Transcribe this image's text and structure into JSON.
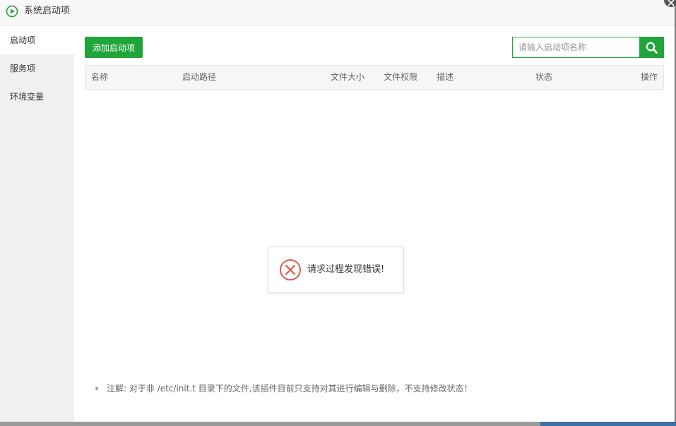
{
  "window": {
    "title": "系统启动项",
    "icon": "play-circle-icon"
  },
  "sidebar": {
    "items": [
      {
        "label": "启动项",
        "active": true
      },
      {
        "label": "服务项",
        "active": false
      },
      {
        "label": "环境变量",
        "active": false
      }
    ]
  },
  "toolbar": {
    "add_label": "添加启动项",
    "search_placeholder": "请输入启动项名称",
    "search_value": "",
    "search_icon": "search-icon"
  },
  "table": {
    "columns": [
      "名称",
      "启动路径",
      "文件大小",
      "文件权限",
      "描述",
      "状态",
      "操作"
    ],
    "rows": []
  },
  "toast": {
    "message": "请求过程发现错误!",
    "icon": "error-x-icon"
  },
  "note": {
    "text": "注解: 对于非 /etc/init.t 目录下的文件,该插件目前只支持对其进行编辑与删除，不支持修改状态！"
  },
  "colors": {
    "accent": "#20a53a",
    "error": "#e05b4a"
  }
}
